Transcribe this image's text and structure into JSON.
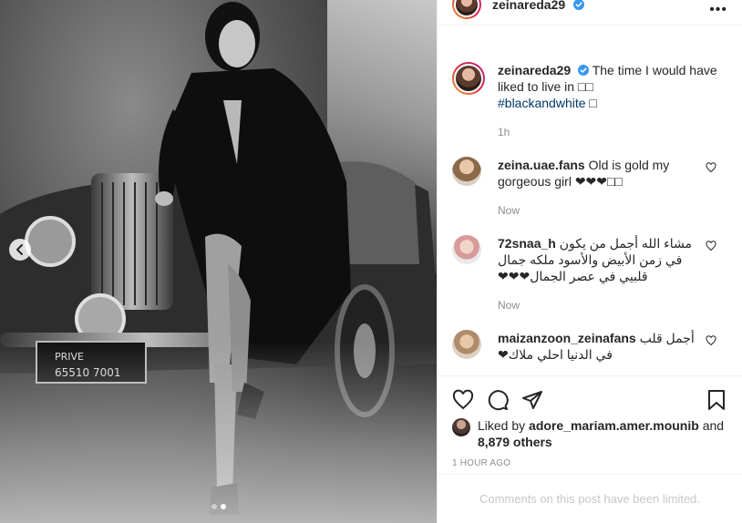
{
  "post": {
    "username": "zeinareda29",
    "caption_text": "The time I would have liked to live in □□",
    "hashtag": "#blackandwhite",
    "caption_suffix": "□",
    "time": "1h"
  },
  "comments": [
    {
      "username": "zeina.uae.fans",
      "text": "Old is gold my gorgeous girl ❤❤❤□□",
      "time": "Now"
    },
    {
      "username": "72snaa_h",
      "text": "مشاء الله أجمل من يكون في زمن الأبيض والأسود ملكه جمال قلبيي في عصر الجمال❤❤❤",
      "time": "Now"
    },
    {
      "username": "maizanzoon_zeinafans",
      "text": "أجمل قلب في الدنيا احلي ملاك❤",
      "time": ""
    }
  ],
  "likes": {
    "prefix": "Liked by",
    "user": "adore_mariam.amer.mounib",
    "and": "and",
    "others": "8,879 others"
  },
  "timestamp": "1 HOUR AGO",
  "comments_limited": "Comments on this post have been limited.",
  "icons": [
    "chevron-left-icon",
    "more-icon",
    "verified-icon",
    "heart-icon",
    "comment-icon",
    "share-icon",
    "bookmark-icon"
  ],
  "colors": {
    "verified": "#3897f0",
    "link": "#00376b",
    "muted": "#8e8e8e"
  }
}
